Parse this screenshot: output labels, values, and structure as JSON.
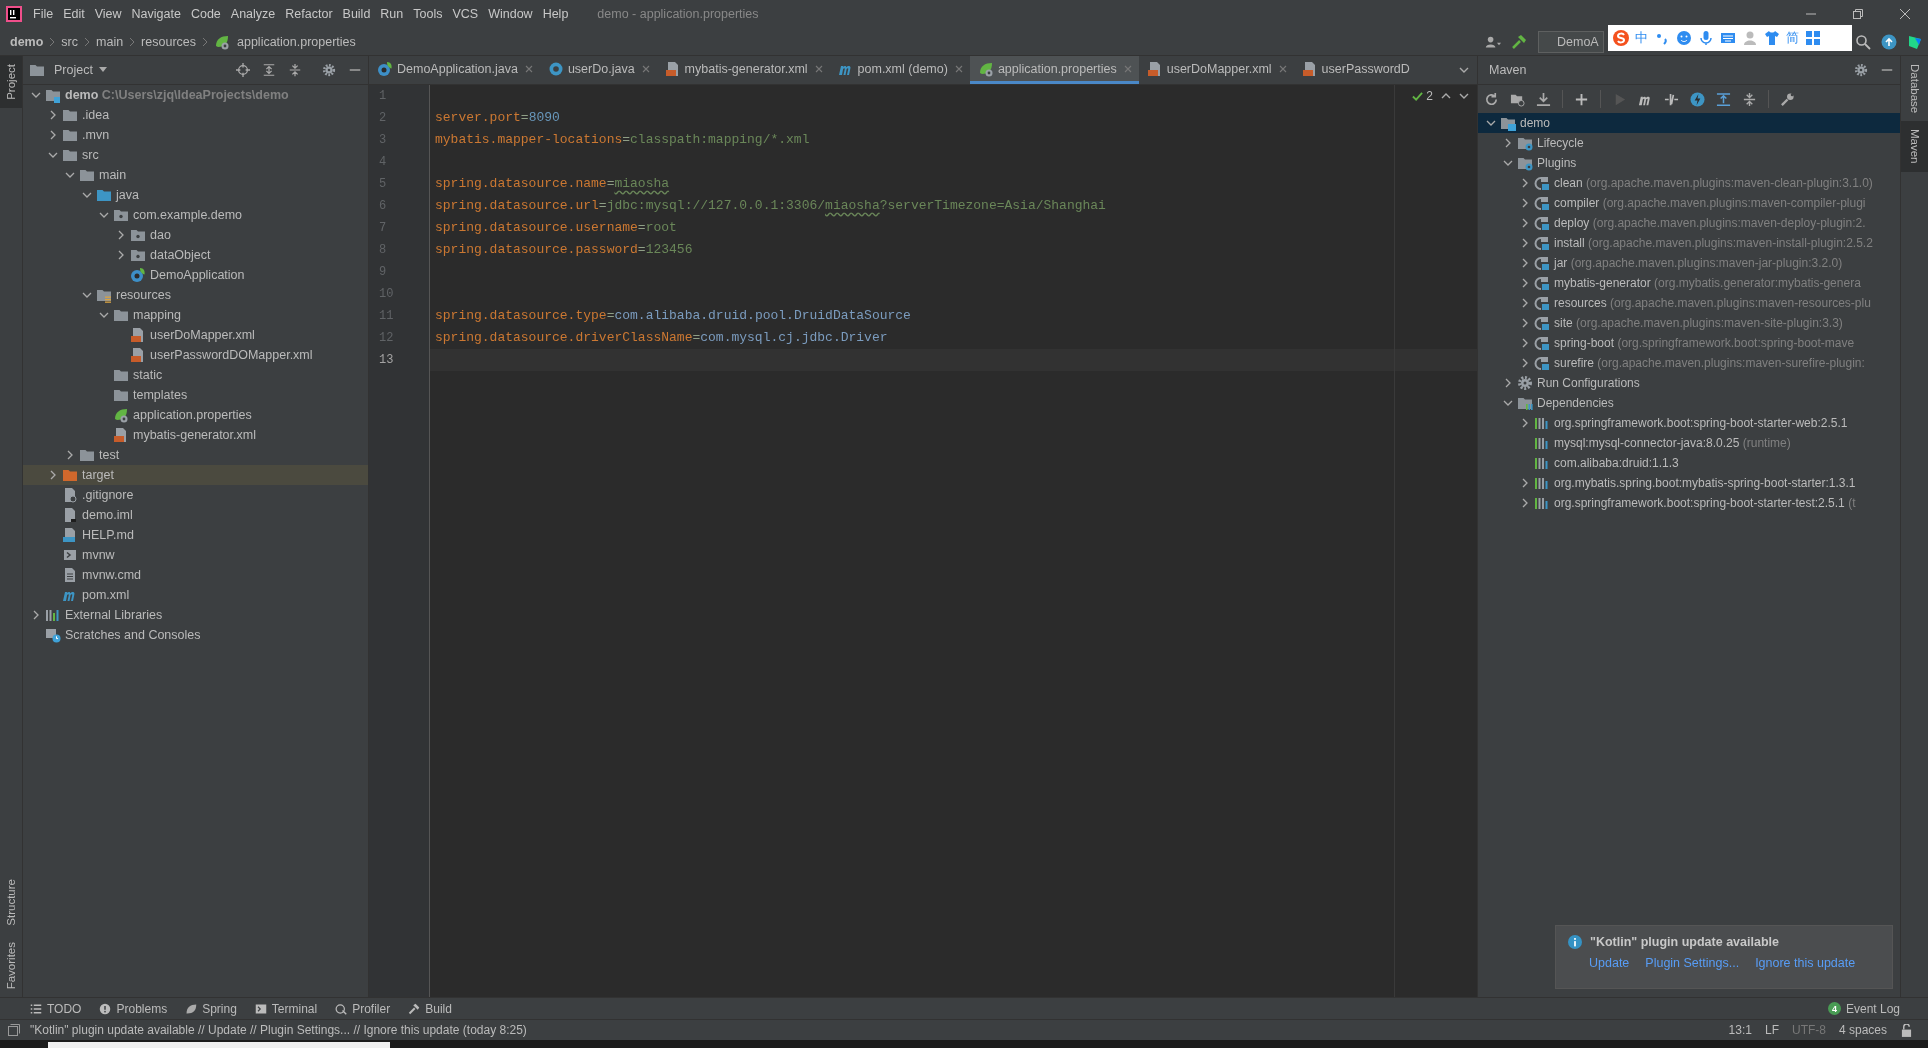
{
  "menu_bar": {
    "items": [
      "File",
      "Edit",
      "View",
      "Navigate",
      "Code",
      "Analyze",
      "Refactor",
      "Build",
      "Run",
      "Tools",
      "VCS",
      "Window",
      "Help"
    ],
    "title": "demo - application.properties"
  },
  "breadcrumbs": [
    {
      "label": "demo",
      "kind": "root"
    },
    {
      "label": "src",
      "kind": "plain"
    },
    {
      "label": "main",
      "kind": "plain"
    },
    {
      "label": "resources",
      "kind": "plain"
    },
    {
      "label": "application.properties",
      "kind": "props"
    }
  ],
  "run_config": {
    "label": "DemoA"
  },
  "ime_toolbar": {
    "labels": [
      "中",
      "简"
    ]
  },
  "left_strip": {
    "top": [
      {
        "label": "Project",
        "selected": true
      }
    ],
    "bottom": [
      {
        "label": "Structure",
        "selected": false
      },
      {
        "label": "Favorites",
        "selected": false
      }
    ]
  },
  "right_strip": [
    {
      "label": "Database",
      "selected": false
    },
    {
      "label": "Maven",
      "selected": true
    }
  ],
  "project": {
    "title": "Project",
    "tree": [
      {
        "label": "demo",
        "kind": "module",
        "detail": "C:\\Users\\zjq\\IdeaProjects\\demo",
        "expanded": true,
        "selected": false,
        "children": [
          {
            "label": ".idea",
            "kind": "folder",
            "expanded": false,
            "selected": false
          },
          {
            "label": ".mvn",
            "kind": "folder",
            "expanded": false,
            "selected": false
          },
          {
            "label": "src",
            "kind": "folder",
            "expanded": true,
            "selected": false,
            "children": [
              {
                "label": "main",
                "kind": "folder",
                "expanded": true,
                "selected": false,
                "children": [
                  {
                    "label": "java",
                    "kind": "source",
                    "expanded": true,
                    "selected": false,
                    "children": [
                      {
                        "label": "com.example.demo",
                        "kind": "package",
                        "expanded": true,
                        "selected": false,
                        "children": [
                          {
                            "label": "dao",
                            "kind": "package",
                            "expanded": false,
                            "selected": false
                          },
                          {
                            "label": "dataObject",
                            "kind": "package",
                            "expanded": false,
                            "selected": false
                          },
                          {
                            "label": "DemoApplication",
                            "kind": "springclass",
                            "selected": false
                          }
                        ]
                      }
                    ]
                  },
                  {
                    "label": "resources",
                    "kind": "resources",
                    "expanded": true,
                    "selected": false,
                    "children": [
                      {
                        "label": "mapping",
                        "kind": "folder",
                        "expanded": true,
                        "selected": false,
                        "children": [
                          {
                            "label": "userDoMapper.xml",
                            "kind": "xml",
                            "selected": false
                          },
                          {
                            "label": "userPasswordDOMapper.xml",
                            "kind": "xml",
                            "selected": false
                          }
                        ]
                      },
                      {
                        "label": "static",
                        "kind": "folder",
                        "selected": false
                      },
                      {
                        "label": "templates",
                        "kind": "folder",
                        "selected": false
                      },
                      {
                        "label": "application.properties",
                        "kind": "props",
                        "selected": false
                      },
                      {
                        "label": "mybatis-generator.xml",
                        "kind": "xml",
                        "selected": false
                      }
                    ]
                  }
                ]
              },
              {
                "label": "test",
                "kind": "folder",
                "expanded": false,
                "selected": false
              }
            ]
          },
          {
            "label": "target",
            "kind": "excluded",
            "expanded": false,
            "selected": true
          },
          {
            "label": ".gitignore",
            "kind": "gitignore",
            "selected": false
          },
          {
            "label": "demo.iml",
            "kind": "iml",
            "selected": false
          },
          {
            "label": "HELP.md",
            "kind": "md",
            "selected": false
          },
          {
            "label": "mvnw",
            "kind": "script",
            "selected": false
          },
          {
            "label": "mvnw.cmd",
            "kind": "textfile",
            "selected": false
          },
          {
            "label": "pom.xml",
            "kind": "maven",
            "selected": false
          }
        ]
      },
      {
        "label": "External Libraries",
        "kind": "libraries",
        "expanded": false,
        "selected": false
      },
      {
        "label": "Scratches and Consoles",
        "kind": "scratches",
        "selected": false
      }
    ]
  },
  "editor": {
    "tabs": [
      {
        "label": "DemoApplication.java",
        "kind": "springclass",
        "selected": false,
        "closable": true
      },
      {
        "label": "userDo.java",
        "kind": "java",
        "selected": false,
        "closable": true
      },
      {
        "label": "mybatis-generator.xml",
        "kind": "xml",
        "selected": false,
        "closable": true
      },
      {
        "label": "pom.xml (demo)",
        "kind": "maven",
        "selected": false,
        "closable": true
      },
      {
        "label": "application.properties",
        "kind": "props",
        "selected": true,
        "closable": true
      },
      {
        "label": "userDoMapper.xml",
        "kind": "xml",
        "selected": false,
        "closable": true
      },
      {
        "label": "userPasswordD",
        "kind": "xml",
        "selected": false,
        "closable": false
      }
    ],
    "inspection_count": "2",
    "lines": [
      {
        "number": "1",
        "current": false
      },
      {
        "number": "2",
        "current": false,
        "segments": [
          {
            "kind": "key",
            "text": "server.port"
          },
          {
            "kind": "sep",
            "text": "="
          },
          {
            "kind": "number",
            "text": "8090"
          }
        ]
      },
      {
        "number": "3",
        "current": false,
        "segments": [
          {
            "kind": "key",
            "text": "mybatis.mapper-locations"
          },
          {
            "kind": "sep",
            "text": "="
          },
          {
            "kind": "string",
            "text": "classpath:mapping/*.xml"
          }
        ]
      },
      {
        "number": "4",
        "current": false
      },
      {
        "number": "5",
        "current": false,
        "segments": [
          {
            "kind": "key",
            "text": "spring.datasource.name"
          },
          {
            "kind": "sep",
            "text": "="
          },
          {
            "kind": "typo",
            "text": "miaosha"
          }
        ]
      },
      {
        "number": "6",
        "current": false,
        "segments": [
          {
            "kind": "key",
            "text": "spring.datasource.url"
          },
          {
            "kind": "sep",
            "text": "="
          },
          {
            "kind": "string",
            "text": "jdbc:mysql://127.0.0.1:3306/"
          },
          {
            "kind": "typo",
            "text": "miaosha"
          },
          {
            "kind": "string",
            "text": "?serverTimezone=Asia/Shanghai"
          }
        ]
      },
      {
        "number": "7",
        "current": false,
        "segments": [
          {
            "kind": "key",
            "text": "spring.datasource.username"
          },
          {
            "kind": "sep",
            "text": "="
          },
          {
            "kind": "string",
            "text": "root"
          }
        ]
      },
      {
        "number": "8",
        "current": false,
        "segments": [
          {
            "kind": "key",
            "text": "spring.datasource.password"
          },
          {
            "kind": "sep",
            "text": "="
          },
          {
            "kind": "string",
            "text": "123456"
          }
        ]
      },
      {
        "number": "9",
        "current": false
      },
      {
        "number": "10",
        "current": false
      },
      {
        "number": "11",
        "current": false,
        "segments": [
          {
            "kind": "key",
            "text": "spring.datasource.type"
          },
          {
            "kind": "sep",
            "text": "="
          },
          {
            "kind": "class",
            "text": "com.alibaba.druid.pool.DruidDataSource"
          }
        ]
      },
      {
        "number": "12",
        "current": false,
        "segments": [
          {
            "kind": "key",
            "text": "spring.datasource.driverClassName"
          },
          {
            "kind": "sep",
            "text": "="
          },
          {
            "kind": "class",
            "text": "com.mysql.cj.jdbc.Driver"
          }
        ]
      },
      {
        "number": "13",
        "current": true
      }
    ]
  },
  "maven": {
    "title": "Maven",
    "tree": [
      {
        "label": "demo",
        "kind": "mavenmodule",
        "expanded": true,
        "selected": true,
        "children": [
          {
            "label": "Lifecycle",
            "kind": "gearfolder",
            "expanded": false,
            "selected": false
          },
          {
            "label": "Plugins",
            "kind": "gearfolder",
            "expanded": true,
            "selected": false,
            "children": [
              {
                "label": "clean",
                "kind": "plugin",
                "detail": "(org.apache.maven.plugins:maven-clean-plugin:3.1.0)",
                "expanded": false,
                "selected": false
              },
              {
                "label": "compiler",
                "kind": "plugin",
                "detail": "(org.apache.maven.plugins:maven-compiler-plugi",
                "expanded": false,
                "selected": false
              },
              {
                "label": "deploy",
                "kind": "plugin",
                "detail": "(org.apache.maven.plugins:maven-deploy-plugin:2.",
                "expanded": false,
                "selected": false
              },
              {
                "label": "install",
                "kind": "plugin",
                "detail": "(org.apache.maven.plugins:maven-install-plugin:2.5.2",
                "expanded": false,
                "selected": false
              },
              {
                "label": "jar",
                "kind": "plugin",
                "detail": "(org.apache.maven.plugins:maven-jar-plugin:3.2.0)",
                "expanded": false,
                "selected": false
              },
              {
                "label": "mybatis-generator",
                "kind": "plugin",
                "detail": "(org.mybatis.generator:mybatis-genera",
                "expanded": false,
                "selected": false
              },
              {
                "label": "resources",
                "kind": "plugin",
                "detail": "(org.apache.maven.plugins:maven-resources-plu",
                "expanded": false,
                "selected": false
              },
              {
                "label": "site",
                "kind": "plugin",
                "detail": "(org.apache.maven.plugins:maven-site-plugin:3.3)",
                "expanded": false,
                "selected": false
              },
              {
                "label": "spring-boot",
                "kind": "plugin",
                "detail": "(org.springframework.boot:spring-boot-mave",
                "expanded": false,
                "selected": false
              },
              {
                "label": "surefire",
                "kind": "plugin",
                "detail": "(org.apache.maven.plugins:maven-surefire-plugin:",
                "expanded": false,
                "selected": false
              }
            ]
          },
          {
            "label": "Run Configurations",
            "kind": "gear",
            "expanded": false,
            "selected": false
          },
          {
            "label": "Dependencies",
            "kind": "depfolder",
            "expanded": true,
            "selected": false,
            "children": [
              {
                "label": "org.springframework.boot:spring-boot-starter-web:2.5.1",
                "kind": "library",
                "expanded": false,
                "selected": false
              },
              {
                "label": "mysql:mysql-connector-java:8.0.25",
                "kind": "library",
                "detail": "(runtime)",
                "selected": false
              },
              {
                "label": "com.alibaba:druid:1.1.3",
                "kind": "library",
                "selected": false
              },
              {
                "label": "org.mybatis.spring.boot:mybatis-spring-boot-starter:1.3.1",
                "kind": "library",
                "expanded": false,
                "selected": false
              },
              {
                "label": "org.springframework.boot:spring-boot-starter-test:2.5.1",
                "kind": "library",
                "detail": "(t",
                "expanded": false,
                "selected": false
              }
            ]
          }
        ]
      }
    ]
  },
  "tool_tabs": [
    {
      "label": "TODO",
      "kind": "todo"
    },
    {
      "label": "Problems",
      "kind": "problems"
    },
    {
      "label": "Spring",
      "kind": "spring"
    },
    {
      "label": "Terminal",
      "kind": "terminal"
    },
    {
      "label": "Profiler",
      "kind": "profiler"
    },
    {
      "label": "Build",
      "kind": "build"
    }
  ],
  "event_log": {
    "label": "Event Log",
    "badge": "4"
  },
  "status_bar": {
    "message": "\"Kotlin\" plugin update available // Update // Plugin Settings... // Ignore this update (today 8:25)",
    "position": "13:1",
    "line_separator": "LF",
    "encoding": "UTF-8",
    "indent": "4 spaces"
  },
  "notification": {
    "title": "\"Kotlin\" plugin update available",
    "links": [
      "Update",
      "Plugin Settings...",
      "Ignore this update"
    ]
  }
}
